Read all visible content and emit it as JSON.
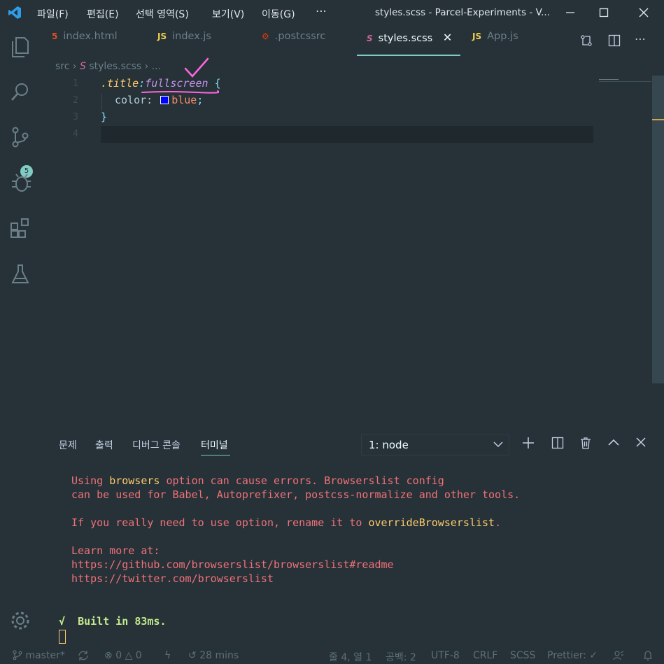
{
  "menu": [
    "파일(F)",
    "편집(E)",
    "선택 영역(S)",
    "보기(V)",
    "이동(G)"
  ],
  "window_title": "styles.scss - Parcel-Experiments - V...",
  "tabs": [
    {
      "icon": "5",
      "label": "index.html"
    },
    {
      "icon": "JS",
      "label": "index.js"
    },
    {
      "icon": "⚙",
      "label": ".postcssrc"
    },
    {
      "icon": "S",
      "label": "styles.scss"
    },
    {
      "icon": "JS",
      "label": "App.js"
    }
  ],
  "breadcrumb": {
    "folder": "src",
    "file": "styles.scss",
    "more": "..."
  },
  "editor": {
    "line_numbers": [
      "1",
      "2",
      "3",
      "4"
    ],
    "line1": {
      "selector": ".title",
      "colon": ":",
      "pseudo": "fullscreen",
      "brace": "{"
    },
    "line2": {
      "prop": "color:",
      "value": "blue",
      "semi": ";",
      "swatch_color": "#0000ff"
    },
    "line3": {
      "brace": "}"
    }
  },
  "activity_badge": "5",
  "panel": {
    "tabs": [
      "문제",
      "출력",
      "디버그 콘솔",
      "터미널"
    ],
    "terminal_select": "1: node",
    "lines": {
      "l1a": "Using ",
      "l1b": "browsers",
      "l1c": " option can cause errors. Browserslist config",
      "l2": "can be used for Babel, Autoprefixer, postcss-normalize and other tools.",
      "l3a": "If you really need to use option, rename it to ",
      "l3b": "overrideBrowserslist",
      "l3c": ".",
      "l4": "Learn more at:",
      "l5": "https://github.com/browserslist/browserslist#readme",
      "l6": "https://twitter.com/browserslist"
    },
    "built": "√  Built in 83ms."
  },
  "status": {
    "branch": "master*",
    "errors": "0",
    "warnings": "0",
    "time": "28 mins",
    "position": "줄 4, 열 1",
    "spaces": "공백: 2",
    "encoding": "UTF-8",
    "eol": "CRLF",
    "language": "SCSS",
    "prettier": "Prettier: ✓"
  },
  "colors": {
    "accent": "#80cbc4",
    "bg": "#263238",
    "terminal_text": "#f07178",
    "annotation": "#ff66e0"
  }
}
